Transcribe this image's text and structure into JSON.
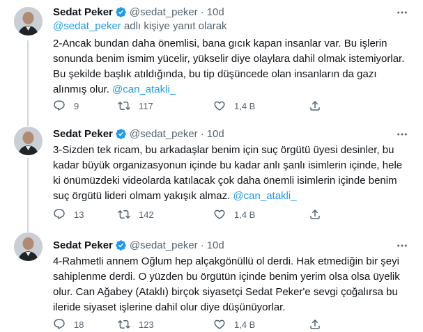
{
  "tweets": [
    {
      "name": "Sedat Peker",
      "handle": "@sedat_peker",
      "dot": "·",
      "time": "10d",
      "reply_handle": "@sedat_peker",
      "reply_suffix": "adlı kişiye yanıt olarak",
      "lines": [
        "2-Ancak bundan daha önemlisi, bana gıcık kapan insanlar var. Bu işlerin",
        "sonunda benim ismim yücelir, yükselir diye olaylara dahil olmak istemiyorlar.",
        "Bu şekilde başlık atıldığında, bu tip düşüncede olan insanların da gazı",
        "alınmış olur."
      ],
      "mention": "@can_atakli_",
      "replies": "9",
      "retweets": "117",
      "likes": "1,4 B"
    },
    {
      "name": "Sedat Peker",
      "handle": "@sedat_peker",
      "dot": "·",
      "time": "10d",
      "lines": [
        "3-Sizden tek ricam, bu arkadaşlar benim için suç örgütü üyesi desinler, bu",
        "kadar büyük organizasyonun içinde bu kadar anlı şanlı isimlerin içinde, hele",
        "ki önümüzdeki videolarda katılacak çok daha önemli isimlerin içinde benim",
        "suç örgütü lideri olmam yakışık almaz."
      ],
      "mention": "@can_atakli_",
      "replies": "13",
      "retweets": "142",
      "likes": "1,4 B"
    },
    {
      "name": "Sedat Peker",
      "handle": "@sedat_peker",
      "dot": "·",
      "time": "10d",
      "lines": [
        "4-Rahmetli annem Oğlum hep alçakgönüllü ol derdi. Hak etmediğin bir şeyi",
        "sahiplenme derdi. O yüzden bu örgütün içinde benim yerim olsa olsa üyelik",
        "olur. Can Ağabey (Ataklı) birçok siyasetçi Sedat Peker'e sevgi çoğalırsa bu",
        "ileride siyaset işlerine dahil olur diye düşünüyorlar."
      ],
      "replies": "18",
      "retweets": "123",
      "likes": "1,4 B"
    }
  ],
  "colors": {
    "link": "#1d9bf0",
    "muted": "#536471",
    "text": "#0f1419"
  },
  "icons": [
    "avatar",
    "verified-badge-icon",
    "more-icon",
    "reply-icon",
    "retweet-icon",
    "like-icon",
    "share-icon"
  ]
}
